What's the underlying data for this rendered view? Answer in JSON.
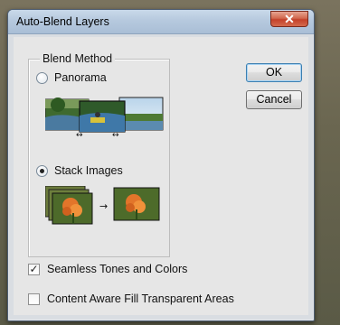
{
  "window": {
    "title": "Auto-Blend Layers",
    "close_glyph": "✕"
  },
  "blend_method": {
    "legend": "Blend Method",
    "options": [
      {
        "label": "Panorama",
        "selected": false
      },
      {
        "label": "Stack Images",
        "selected": true
      }
    ]
  },
  "buttons": {
    "ok": "OK",
    "cancel": "Cancel"
  },
  "checkboxes": [
    {
      "label": "Seamless Tones and Colors",
      "checked": true,
      "glyph": "✓"
    },
    {
      "label": "Content Aware Fill Transparent Areas",
      "checked": false,
      "glyph": ""
    }
  ],
  "icons": {
    "panorama": "panorama-preview-icon",
    "stack": "stack-preview-icon",
    "arrow_left_right": "↔",
    "arrow_right": "→"
  },
  "colors": {
    "title_gradient_top": "#c9d9ea",
    "close_red": "#c4412a",
    "dialog_bg": "#e6e6e6",
    "default_button_border": "#3c7fb1"
  }
}
